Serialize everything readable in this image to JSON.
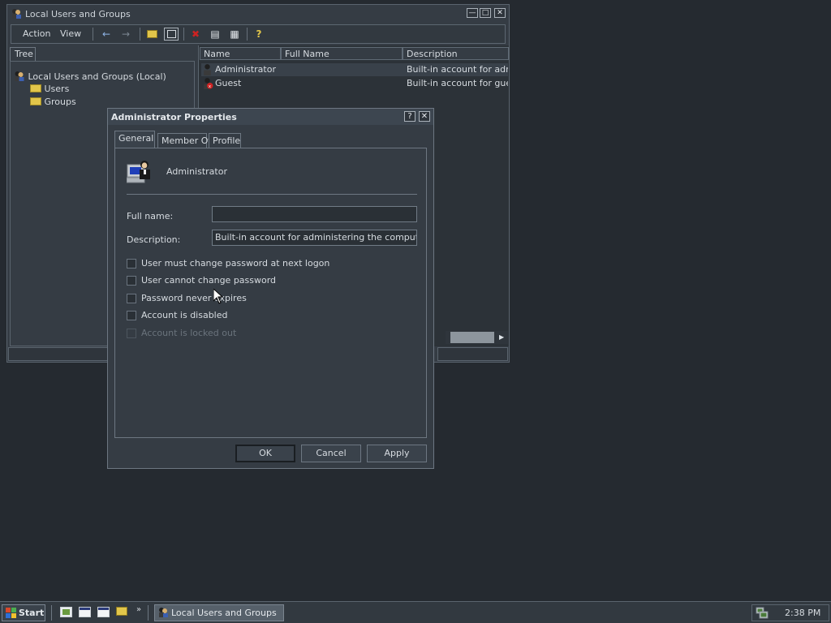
{
  "mmc": {
    "title": "Local Users and Groups",
    "menu": {
      "action": "Action",
      "view": "View"
    },
    "toolbar_icons": [
      "back-arrow-icon",
      "forward-arrow-icon",
      "up-folder-icon",
      "show-hide-tree-icon",
      "delete-icon",
      "properties-icon",
      "export-list-icon",
      "help-icon"
    ],
    "tree_tab": "Tree",
    "tree": {
      "root": "Local Users and Groups (Local)",
      "children": [
        "Users",
        "Groups"
      ]
    },
    "list": {
      "columns": [
        "Name",
        "Full Name",
        "Description"
      ],
      "rows": [
        {
          "name": "Administrator",
          "full_name": "",
          "description": "Built-in account for admini"
        },
        {
          "name": "Guest",
          "full_name": "",
          "description": "Built-in account for guest a"
        }
      ]
    }
  },
  "dialog": {
    "title": "Administrator Properties",
    "tabs": [
      "General",
      "Member Of",
      "Profile"
    ],
    "active_tab": "General",
    "user_name": "Administrator",
    "full_name_label": "Full name:",
    "full_name_value": "",
    "description_label": "Description:",
    "description_value": "Built-in account for administering the computer/doma",
    "checkboxes": [
      {
        "label": "User must change password at next logon",
        "checked": false,
        "enabled": true
      },
      {
        "label": "User cannot change password",
        "checked": false,
        "enabled": true
      },
      {
        "label": "Password never expires",
        "checked": false,
        "enabled": true
      },
      {
        "label": "Account is disabled",
        "checked": false,
        "enabled": true
      },
      {
        "label": "Account is locked out",
        "checked": false,
        "enabled": false
      }
    ],
    "buttons": {
      "ok": "OK",
      "cancel": "Cancel",
      "apply": "Apply"
    }
  },
  "taskbar": {
    "start_label": "Start",
    "quick_launch": [
      "show-desktop-icon",
      "window-icon",
      "window-icon",
      "explorer-icon"
    ],
    "task_label": "Local Users and Groups",
    "clock": "2:38 PM"
  },
  "colors": {
    "desktop": "#252a30",
    "window": "#353c44",
    "text": "#d6dbe0",
    "folder": "#e2c64a",
    "delete_red": "#cc2222"
  }
}
